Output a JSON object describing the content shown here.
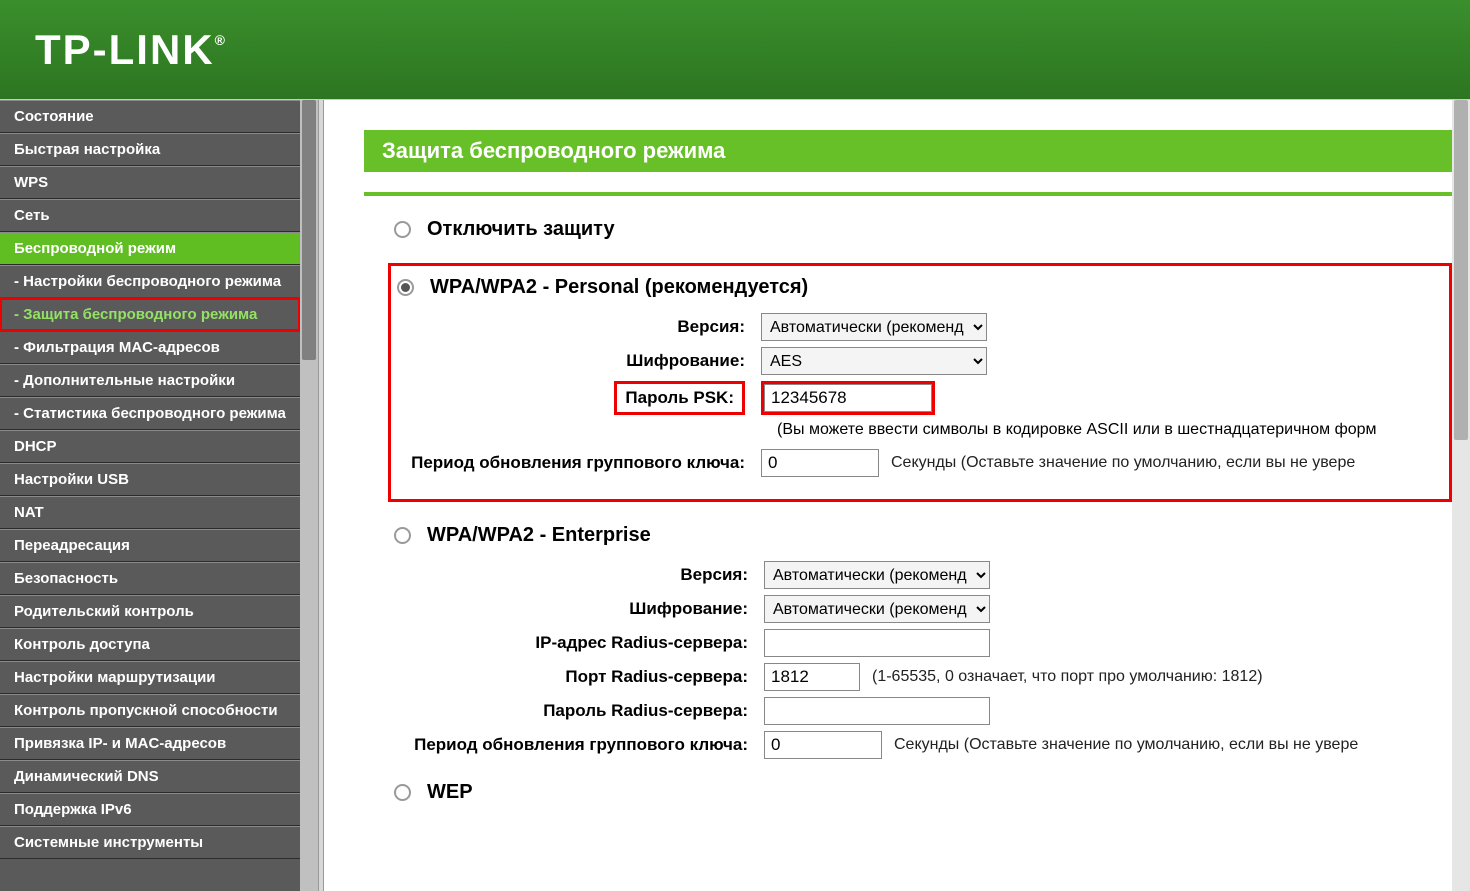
{
  "brand": "TP-LINK",
  "sidebar": {
    "items": [
      {
        "label": "Состояние"
      },
      {
        "label": "Быстрая настройка"
      },
      {
        "label": "WPS"
      },
      {
        "label": "Сеть"
      },
      {
        "label": "Беспроводной режим",
        "active_section": true
      },
      {
        "label": "- Настройки беспроводного режима"
      },
      {
        "label": "- Защита беспроводного режима",
        "active_sub": true
      },
      {
        "label": "- Фильтрация MAC-адресов"
      },
      {
        "label": "- Дополнительные настройки"
      },
      {
        "label": "- Статистика беспроводного режима"
      },
      {
        "label": "DHCP"
      },
      {
        "label": "Настройки USB"
      },
      {
        "label": "NAT"
      },
      {
        "label": "Переадресация"
      },
      {
        "label": "Безопасность"
      },
      {
        "label": "Родительский контроль"
      },
      {
        "label": "Контроль доступа"
      },
      {
        "label": "Настройки маршрутизации"
      },
      {
        "label": "Контроль пропускной способности"
      },
      {
        "label": "Привязка IP- и MAC-адресов"
      },
      {
        "label": "Динамический DNS"
      },
      {
        "label": "Поддержка IPv6"
      },
      {
        "label": "Системные инструменты"
      }
    ]
  },
  "page": {
    "title": "Защита беспроводного режима"
  },
  "disable": {
    "label": "Отключить защиту"
  },
  "wpa_personal": {
    "label": "WPA/WPA2 - Personal (рекомендуется)",
    "version_label": "Версия:",
    "version_value": "Автоматически (рекоменд",
    "encryption_label": "Шифрование:",
    "encryption_value": "AES",
    "psk_label": "Пароль PSK:",
    "psk_value": "12345678",
    "psk_note": "(Вы можете ввести символы в кодировке ASCII или в шестнадцатеричном форм",
    "group_label": "Период обновления группового ключа:",
    "group_value": "0",
    "group_hint": "Секунды (Оставьте значение по умолчанию, если вы не увере"
  },
  "wpa_enterprise": {
    "label": "WPA/WPA2 - Enterprise",
    "version_label": "Версия:",
    "version_value": "Автоматически (рекоменд",
    "encryption_label": "Шифрование:",
    "encryption_value": "Автоматически (рекоменд",
    "radius_ip_label": "IP-адрес Radius-сервера:",
    "radius_ip_value": "",
    "radius_port_label": "Порт Radius-сервера:",
    "radius_port_value": "1812",
    "radius_port_hint": "(1-65535, 0 означает, что порт про умолчанию: 1812)",
    "radius_pw_label": "Пароль Radius-сервера:",
    "radius_pw_value": "",
    "group_label": "Период обновления группового ключа:",
    "group_value": "0",
    "group_hint": "Секунды (Оставьте значение по умолчанию, если вы не увере"
  },
  "wep": {
    "label": "WEP"
  }
}
